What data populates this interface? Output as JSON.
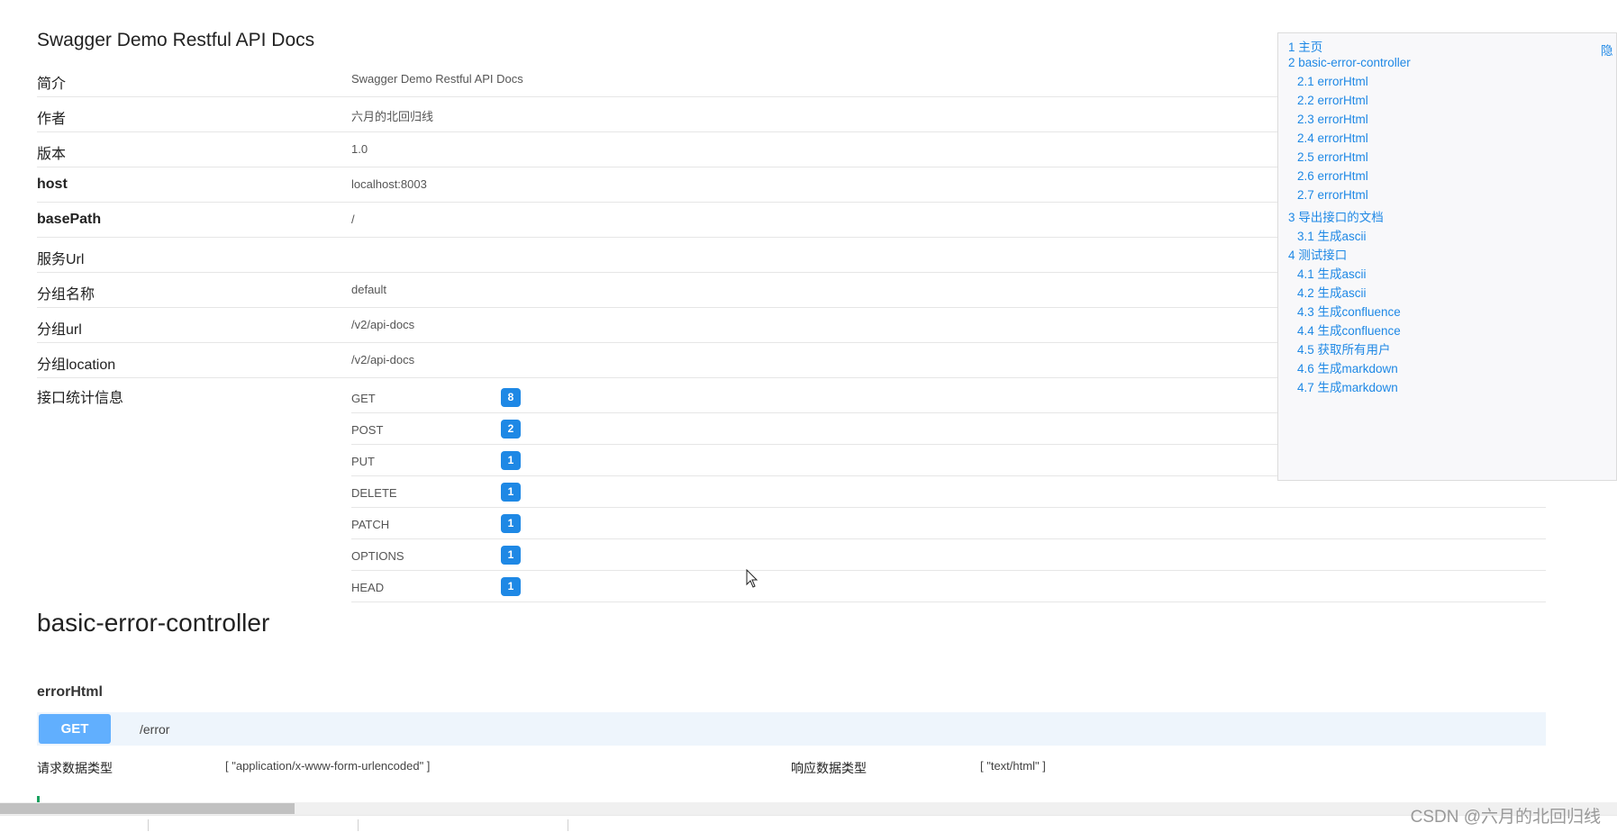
{
  "page": {
    "title": "Swagger Demo Restful API Docs"
  },
  "info_rows": [
    {
      "key": "简介",
      "value": "Swagger Demo Restful API Docs"
    },
    {
      "key": "作者",
      "value": "六月的北回归线"
    },
    {
      "key": "版本",
      "value": "1.0"
    },
    {
      "key": "host",
      "value": "localhost:8003"
    },
    {
      "key": "basePath",
      "value": "/"
    },
    {
      "key": "服务Url",
      "value": ""
    },
    {
      "key": "分组名称",
      "value": "default"
    },
    {
      "key": "分组url",
      "value": "/v2/api-docs"
    },
    {
      "key": "分组location",
      "value": "/v2/api-docs"
    }
  ],
  "stats": {
    "label": "接口统计信息",
    "rows": [
      {
        "method": "GET",
        "count": "8"
      },
      {
        "method": "POST",
        "count": "2"
      },
      {
        "method": "PUT",
        "count": "1"
      },
      {
        "method": "DELETE",
        "count": "1"
      },
      {
        "method": "PATCH",
        "count": "1"
      },
      {
        "method": "OPTIONS",
        "count": "1"
      },
      {
        "method": "HEAD",
        "count": "1"
      }
    ]
  },
  "section": {
    "title": "basic-error-controller",
    "operation": {
      "title": "errorHtml",
      "method": "GET",
      "path": "/error",
      "request_label": "请求数据类型",
      "request_value": "[ \"application/x-www-form-urlencoded\" ]",
      "response_label": "响应数据类型",
      "response_value": "[ \"text/html\" ]"
    }
  },
  "toc": {
    "hide_label": "隐",
    "items": [
      "1 主页",
      "2 basic-error-controller",
      "2.1 errorHtml",
      "2.2 errorHtml",
      "2.3 errorHtml",
      "2.4 errorHtml",
      "2.5 errorHtml",
      "2.6 errorHtml",
      "2.7 errorHtml",
      "3 导出接口的文档",
      "3.1 生成ascii",
      "4 测试接口",
      "4.1 生成ascii",
      "4.2 生成ascii",
      "4.3 生成confluence",
      "4.4 生成confluence",
      "4.5 获取所有用户",
      "4.6 生成markdown",
      "4.7 生成markdown"
    ]
  },
  "watermark": "CSDN @六月的北回归线",
  "colors": {
    "accent": "#1e88e5",
    "get_method": "#61affe",
    "op_background": "#eef5fc"
  }
}
